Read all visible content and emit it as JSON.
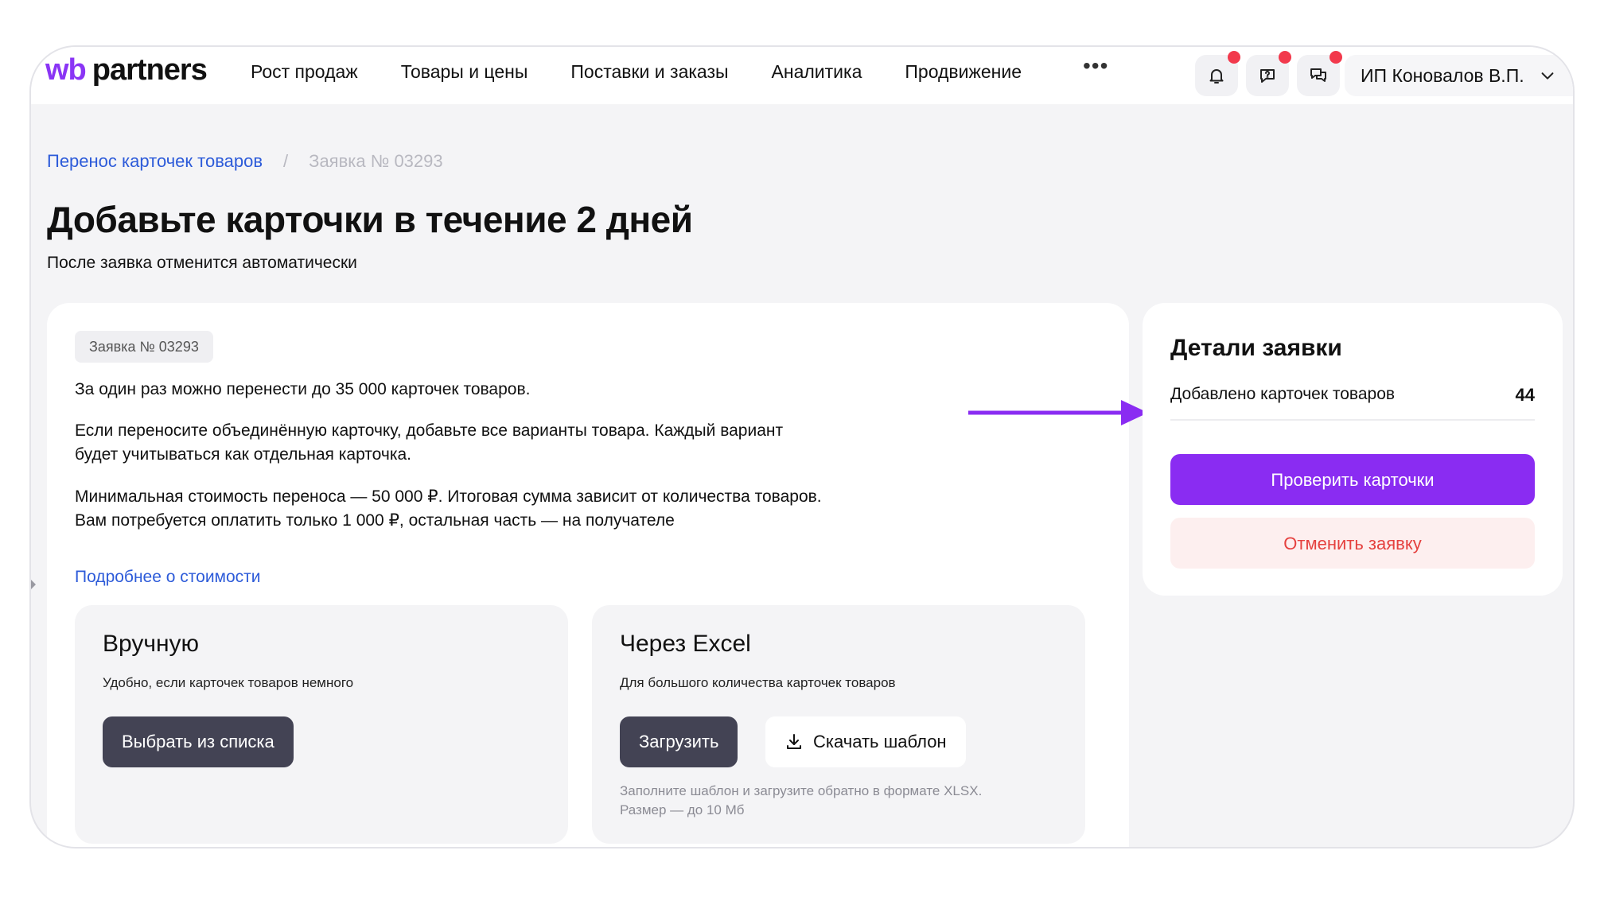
{
  "brand": {
    "wb": "wb",
    "partners": "partners"
  },
  "nav": {
    "items": [
      "Рост продаж",
      "Товары и цены",
      "Поставки и заказы",
      "Аналитика",
      "Продвижение"
    ],
    "more": "•••"
  },
  "account": {
    "name": "ИП Коновалов В.П."
  },
  "breadcrumb": {
    "parent": "Перенос карточек товаров",
    "separator": "/",
    "current": "Заявка № 03293"
  },
  "page": {
    "title": "Добавьте карточки в течение 2 дней",
    "subtitle": "После заявка отменится автоматически"
  },
  "request": {
    "badge": "Заявка № 03293",
    "p1": "За один раз можно перенести до 35 000 карточек товаров.",
    "p2_line1": "Если переносите объединённую карточку, добавьте все варианты товара. Каждый вариант",
    "p2_line2": "будет учитываться как отдельная карточка.",
    "p3_line1": "Минимальная стоимость переноса — 50 000 ₽. Итоговая сумма зависит от количества товаров.",
    "p3_line2": "Вам потребуется оплатить только 1 000 ₽, остальная часть — на получателе",
    "more_link": "Подробнее о стоимости"
  },
  "manual": {
    "title": "Вручную",
    "subtitle": "Удобно, если карточек товаров немного",
    "button": "Выбрать из списка"
  },
  "excel": {
    "title": "Через Excel",
    "subtitle": "Для большого количества карточек товаров",
    "upload_button": "Загрузить",
    "template_button": "Скачать шаблон",
    "hint_line1": "Заполните шаблон и загрузите обратно в формате XLSX.",
    "hint_line2": "Размер — до 10 Мб"
  },
  "details": {
    "title": "Детали заявки",
    "added_label": "Добавлено карточек товаров",
    "added_count": "44",
    "check_button": "Проверить карточки",
    "cancel_button": "Отменить заявку"
  },
  "colors": {
    "accent": "#8a2cf2",
    "notification": "#f2394c",
    "link": "#2d5bd9",
    "cancel": "#e5413f"
  },
  "icons": [
    "bell-icon",
    "help-chat-icon",
    "chat-icon",
    "chevron-down-icon",
    "download-icon",
    "arrow-right-icon"
  ]
}
